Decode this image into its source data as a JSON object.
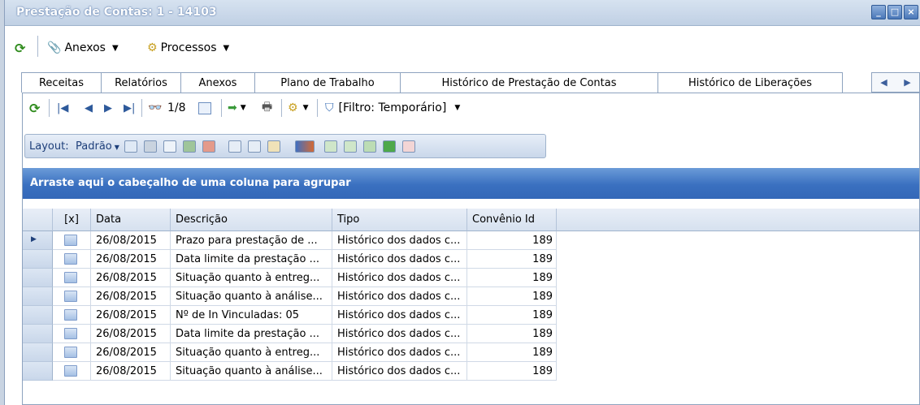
{
  "window": {
    "title": "Prestação de Contas: 1 - 14103",
    "controls": [
      "minimize",
      "maximize",
      "close"
    ]
  },
  "menubar": {
    "refresh_icon": "refresh-icon",
    "anexos_label": "Anexos",
    "processos_label": "Processos"
  },
  "tabs": [
    {
      "label": "Receitas"
    },
    {
      "label": "Relatórios"
    },
    {
      "label": "Anexos"
    },
    {
      "label": "Plano de Trabalho"
    },
    {
      "label": "Histórico de Prestação de Contas"
    },
    {
      "label": "Histórico de Liberações"
    }
  ],
  "toolbar": {
    "record_position": "1/8",
    "filter_label": "[Filtro: Temporário]",
    "layout_label": "Layout:",
    "layout_value": "Padrão"
  },
  "groupbar": {
    "text": "Arraste aqui o cabeçalho de uma coluna para agrupar"
  },
  "grid": {
    "columns": [
      "[x]",
      "Data",
      "Descrição",
      "Tipo",
      "Convênio Id"
    ],
    "rows": [
      {
        "data": "26/08/2015",
        "descricao": "Prazo para prestação de ...",
        "tipo": "Histórico dos dados c...",
        "convenio": "189"
      },
      {
        "data": "26/08/2015",
        "descricao": "Data limite da prestação ...",
        "tipo": "Histórico dos dados c...",
        "convenio": "189"
      },
      {
        "data": "26/08/2015",
        "descricao": "Situação quanto à entreg...",
        "tipo": "Histórico dos dados c...",
        "convenio": "189"
      },
      {
        "data": "26/08/2015",
        "descricao": "Situação quanto à análise...",
        "tipo": "Histórico dos dados c...",
        "convenio": "189"
      },
      {
        "data": "26/08/2015",
        "descricao": "Nº de In Vinculadas: 05",
        "tipo": "Histórico dos dados c...",
        "convenio": "189"
      },
      {
        "data": "26/08/2015",
        "descricao": "Data limite da prestação ...",
        "tipo": "Histórico dos dados c...",
        "convenio": "189"
      },
      {
        "data": "26/08/2015",
        "descricao": "Situação quanto à entreg...",
        "tipo": "Histórico dos dados c...",
        "convenio": "189"
      },
      {
        "data": "26/08/2015",
        "descricao": "Situação quanto à análise...",
        "tipo": "Histórico dos dados c...",
        "convenio": "189"
      }
    ]
  }
}
